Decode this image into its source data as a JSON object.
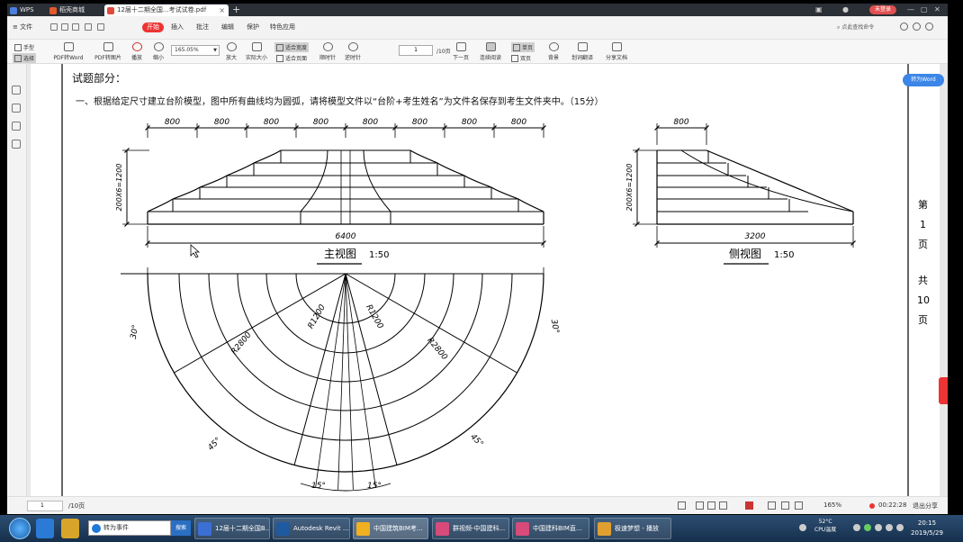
{
  "tabs": [
    {
      "label": "WPS"
    },
    {
      "label": "稻壳商城"
    },
    {
      "label": "12届十二期全国...考试试卷.pdf"
    }
  ],
  "window": {
    "new_tab": "+",
    "login": "未登录"
  },
  "menu": {
    "file": "文件",
    "items": [
      "开始",
      "插入",
      "批注",
      "编辑",
      "保护",
      "特色应用"
    ],
    "search_cmd": "点此查找命令"
  },
  "toolbar": {
    "hand": "手型",
    "select": "选择",
    "pdf_to_word": "PDF转Word",
    "pdf_to_image": "PDF转图片",
    "play": "播放",
    "zoom_out": "缩小",
    "zoom_value": "165.05%",
    "zoom_in": "放大",
    "actual_size": "实际大小",
    "fit_width": "适合宽度",
    "fit_page": "适合页面",
    "rotate_cw": "顺时针",
    "rotate_ccw": "逆时针",
    "page_value": "1",
    "page_total": "/10页",
    "next_page": "下一页",
    "continuous": "连续阅读",
    "single": "单页",
    "double": "双页",
    "background": "背景",
    "translate": "划词翻译",
    "share": "分享文档"
  },
  "to_word_button": "转为Word",
  "doc": {
    "section_title": "试题部分：",
    "question": "一、根据给定尺寸建立台阶模型，图中所有曲线均为圆弧，请将模型文件以“台阶+考生姓名”为文件名保存到考生文件夹中。（15分）",
    "dim_800": "800",
    "dim_height": "200X6=1200",
    "dim_6400": "6400",
    "dim_3200": "3200",
    "front_view_label": "主视图",
    "front_view_scale": "1:50",
    "side_view_label": "侧视图",
    "side_view_scale": "1:50",
    "radius_1200": "R1200",
    "radius_2800": "R2800",
    "angle_30": "30°",
    "angle_45": "45°",
    "angle_15": "15°",
    "page_mark": {
      "c1": "第",
      "c2": "1",
      "c3": "页",
      "c4": "共",
      "c5": "10",
      "c6": "页"
    }
  },
  "status": {
    "page_value": "1",
    "page_total": "/10页",
    "zoom": "165%",
    "timer": "00:22:28",
    "exit_share": "退出分享"
  },
  "taskbar": {
    "search_placeholder": "转为事件",
    "search_btn": "搜索",
    "tasks": [
      "12届十二期全国B...",
      "Autodesk Revit ...",
      "中国建筑BIM考...",
      "群视频-中国建科...",
      "中国建科BIM直...",
      "极速梦想 - 播放"
    ],
    "temp": "52°C",
    "temp_label": "CPU温度",
    "time": "20:15",
    "date": "2019/5/29"
  }
}
